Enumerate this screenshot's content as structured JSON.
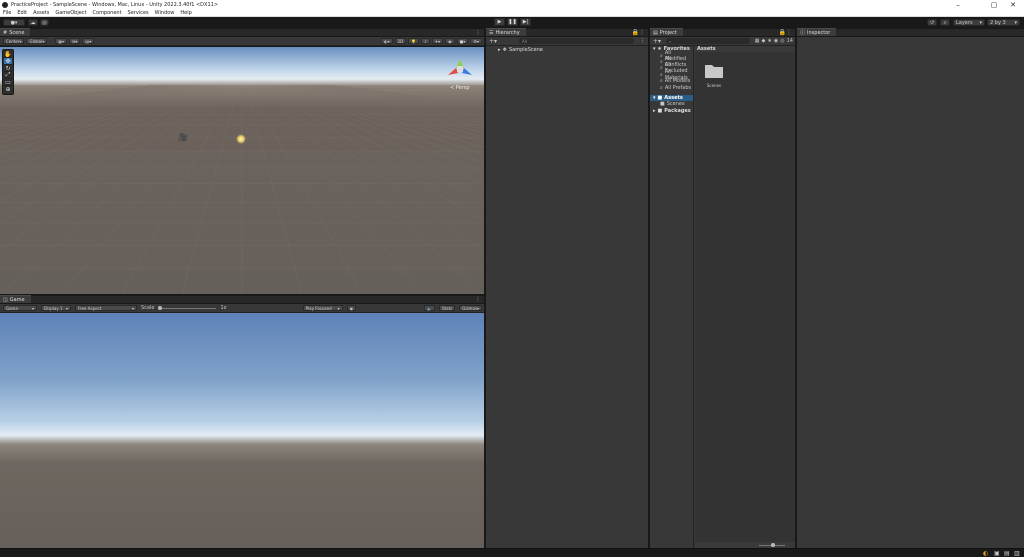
{
  "window": {
    "title": "PracticeProject - SampleScene - Windows, Mac, Linux - Unity 2022.3.40f1 <DX11>",
    "controls": [
      "–",
      "▢",
      "✕"
    ]
  },
  "menu": [
    "File",
    "Edit",
    "Assets",
    "GameObject",
    "Component",
    "Services",
    "Window",
    "Help"
  ],
  "toolbar": {
    "layers_label": "Layers",
    "layout_label": "2 by 3"
  },
  "scene": {
    "tab_label": "Scene",
    "pivot_label": "Center",
    "space_label": "Global",
    "persp_label": "< Persp"
  },
  "game": {
    "tab_label": "Game",
    "mode_label": "Game",
    "display_label": "Display 1",
    "aspect_label": "Free Aspect",
    "scale_label": "Scale",
    "scale_value": "1x",
    "play_focus_label": "Play Focused",
    "stats_label": "Stats",
    "gizmos_label": "Gizmos"
  },
  "hierarchy": {
    "tab_label": "Hierarchy",
    "search_placeholder": "All",
    "scene_name": "SampleScene"
  },
  "project": {
    "tab_label": "Project",
    "favorites_label": "Favorites",
    "favorites": [
      "All Modified",
      "All Conflicts",
      "All Excluded",
      "All Materials",
      "All Models",
      "All Prefabs"
    ],
    "assets_label": "Assets",
    "assets_children": [
      "Scenes"
    ],
    "packages_label": "Packages",
    "content_header": "Assets",
    "folder_label": "Scenes",
    "count_label": "14"
  },
  "inspector": {
    "tab_label": "Inspector"
  },
  "colors": {
    "editor_bg": "#383838",
    "tab_bg": "#3c3c3c",
    "chrome": "#191919",
    "sky_top": "#6a8fbf",
    "ground": "#67605a"
  }
}
